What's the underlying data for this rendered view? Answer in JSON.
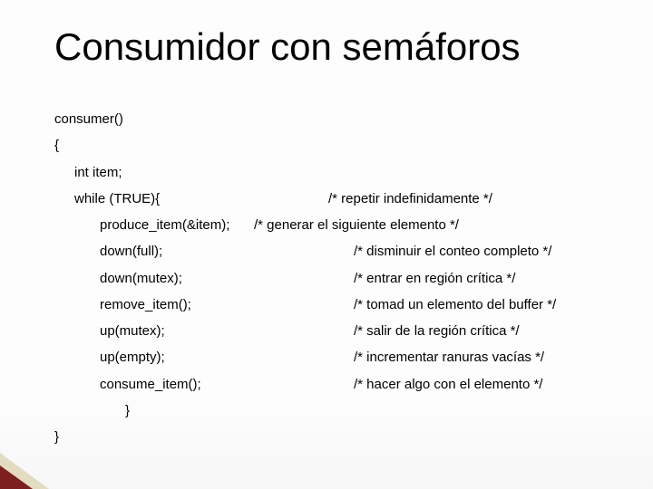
{
  "title": "Consumidor con semáforos",
  "lines": {
    "l0": "consumer()",
    "l1": "{",
    "l2": "int item;",
    "l3_code": "while (TRUE){",
    "l3_comment": "/* repetir indefinidamente */",
    "l4_code": "produce_item(&item);",
    "l4_comment": "/* generar el siguiente elemento */",
    "l5_code": "down(full);",
    "l5_comment": "/* disminuir el conteo completo */",
    "l6_code": "down(mutex);",
    "l6_comment": "/* entrar en región crítica */",
    "l7_code": "remove_item();",
    "l7_comment": "/* tomad un elemento del buffer */",
    "l8_code": "up(mutex);",
    "l8_comment": "/* salir de la región crítica */",
    "l9_code": "up(empty);",
    "l9_comment": "/* incrementar ranuras vacías */",
    "l10_code": "consume_item();",
    "l10_comment": "/* hacer algo con el elemento */",
    "l11": "}",
    "l12": "}"
  }
}
